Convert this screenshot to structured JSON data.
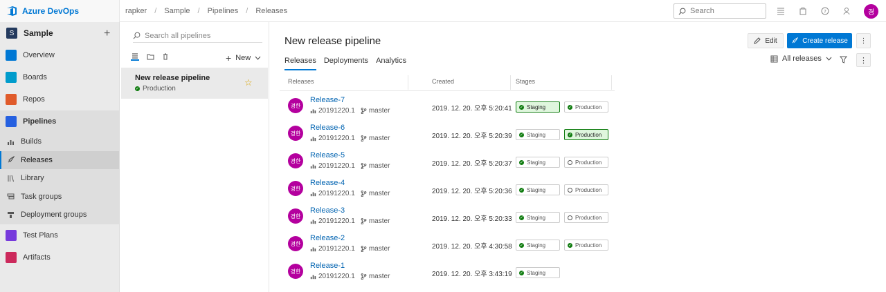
{
  "app": {
    "brand": "Azure DevOps"
  },
  "breadcrumbs": [
    "rapker",
    "Sample",
    "Pipelines",
    "Releases"
  ],
  "search": {
    "placeholder": "Search"
  },
  "user": {
    "initial": "경"
  },
  "colors": {
    "accent": "#0078d4",
    "success": "#107c10",
    "avatar": "#b4009e"
  },
  "sidebar": {
    "project": {
      "initial": "S",
      "name": "Sample"
    },
    "items": [
      {
        "label": "Overview",
        "icon": "overview-icon"
      },
      {
        "label": "Boards",
        "icon": "boards-icon"
      },
      {
        "label": "Repos",
        "icon": "repos-icon"
      },
      {
        "label": "Pipelines",
        "icon": "pipelines-icon"
      }
    ],
    "sub_items": [
      {
        "label": "Builds",
        "icon": "builds-icon"
      },
      {
        "label": "Releases",
        "icon": "rocket-icon"
      },
      {
        "label": "Library",
        "icon": "library-icon"
      },
      {
        "label": "Task groups",
        "icon": "task-groups-icon"
      },
      {
        "label": "Deployment groups",
        "icon": "deployment-groups-icon"
      }
    ],
    "bottom_items": [
      {
        "label": "Test Plans",
        "icon": "test-plans-icon"
      },
      {
        "label": "Artifacts",
        "icon": "artifacts-icon"
      }
    ]
  },
  "pipelines_panel": {
    "search_placeholder": "Search all pipelines",
    "new_label": "New",
    "pipeline": {
      "name": "New release pipeline",
      "status": "Production"
    }
  },
  "main": {
    "title": "New release pipeline",
    "edit_label": "Edit",
    "create_label": "Create release",
    "tabs": [
      "Releases",
      "Deployments",
      "Analytics"
    ],
    "view_selector": "All releases",
    "columns": [
      "Releases",
      "Created",
      "Stages"
    ],
    "releases": [
      {
        "name": "Release-7",
        "build": "20191220.1",
        "branch": "master",
        "created": "2019. 12. 20. 오후 5:20:41",
        "avatar": "경한",
        "stages": [
          {
            "name": "Staging",
            "state": "succeeded",
            "highlight": true
          },
          {
            "name": "Production",
            "state": "succeeded",
            "highlight": false
          }
        ]
      },
      {
        "name": "Release-6",
        "build": "20191220.1",
        "branch": "master",
        "created": "2019. 12. 20. 오후 5:20:39",
        "avatar": "경한",
        "stages": [
          {
            "name": "Staging",
            "state": "succeeded",
            "highlight": false
          },
          {
            "name": "Production",
            "state": "succeeded",
            "highlight": true
          }
        ]
      },
      {
        "name": "Release-5",
        "build": "20191220.1",
        "branch": "master",
        "created": "2019. 12. 20. 오후 5:20:37",
        "avatar": "경한",
        "stages": [
          {
            "name": "Staging",
            "state": "succeeded",
            "highlight": false
          },
          {
            "name": "Production",
            "state": "not-deployed",
            "highlight": false
          }
        ]
      },
      {
        "name": "Release-4",
        "build": "20191220.1",
        "branch": "master",
        "created": "2019. 12. 20. 오후 5:20:36",
        "avatar": "경한",
        "stages": [
          {
            "name": "Staging",
            "state": "succeeded",
            "highlight": false
          },
          {
            "name": "Production",
            "state": "not-deployed",
            "highlight": false
          }
        ]
      },
      {
        "name": "Release-3",
        "build": "20191220.1",
        "branch": "master",
        "created": "2019. 12. 20. 오후 5:20:33",
        "avatar": "경한",
        "stages": [
          {
            "name": "Staging",
            "state": "succeeded",
            "highlight": false
          },
          {
            "name": "Production",
            "state": "not-deployed",
            "highlight": false
          }
        ]
      },
      {
        "name": "Release-2",
        "build": "20191220.1",
        "branch": "master",
        "created": "2019. 12. 20. 오후 4:30:58",
        "avatar": "경한",
        "stages": [
          {
            "name": "Staging",
            "state": "succeeded",
            "highlight": false
          },
          {
            "name": "Production",
            "state": "succeeded",
            "highlight": false
          }
        ]
      },
      {
        "name": "Release-1",
        "build": "20191220.1",
        "branch": "master",
        "created": "2019. 12. 20. 오후 3:43:19",
        "avatar": "경한",
        "stages": [
          {
            "name": "Staging",
            "state": "succeeded",
            "highlight": false
          }
        ]
      }
    ]
  }
}
